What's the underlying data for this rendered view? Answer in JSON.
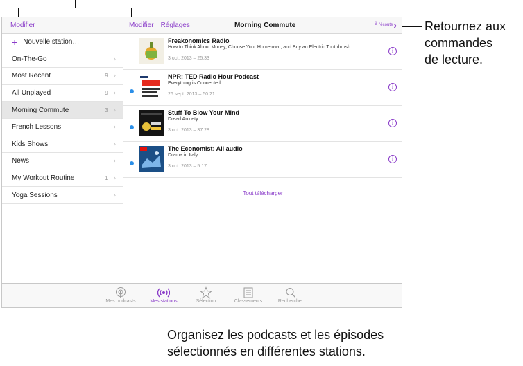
{
  "callouts": {
    "right": [
      "Retournez aux",
      "commandes",
      "de lecture."
    ],
    "bottom": [
      "Organisez les podcasts et les épisodes",
      "sélectionnés en différentes stations."
    ]
  },
  "sidebar": {
    "edit_label": "Modifier",
    "new_station_label": "Nouvelle station…",
    "items": [
      {
        "label": "On-The-Go",
        "count": ""
      },
      {
        "label": "Most Recent",
        "count": "9"
      },
      {
        "label": "All Unplayed",
        "count": "9"
      },
      {
        "label": "Morning Commute",
        "count": "3"
      },
      {
        "label": "French Lessons",
        "count": ""
      },
      {
        "label": "Kids Shows",
        "count": ""
      },
      {
        "label": "News",
        "count": ""
      },
      {
        "label": "My Workout Routine",
        "count": "1"
      },
      {
        "label": "Yoga Sessions",
        "count": ""
      }
    ]
  },
  "main": {
    "edit_label": "Modifier",
    "settings_label": "Réglages",
    "title": "Morning Commute",
    "back_label": "À l'écoute",
    "download_all": "Tout télécharger",
    "episodes": [
      {
        "title": "Freakonomics Radio",
        "subtitle": "How to Think About Money, Choose Your Hometown, and Buy an Electric Toothbrush",
        "date": "3 oct. 2013 – 25:33",
        "unplayed": false,
        "art": "freakonomics"
      },
      {
        "title": "NPR: TED Radio Hour Podcast",
        "subtitle": "Everything is Connected",
        "date": "26 sept. 2013 – 50:21",
        "unplayed": true,
        "art": "ted"
      },
      {
        "title": "Stuff To Blow Your Mind",
        "subtitle": "Dread Anxiety",
        "date": "3 oct. 2013 – 37:28",
        "unplayed": true,
        "art": "stbym"
      },
      {
        "title": "The Economist: All audio",
        "subtitle": "Drama in Italy",
        "date": "3 oct. 2013 – 5:17",
        "unplayed": true,
        "art": "economist"
      }
    ]
  },
  "tabbar": {
    "tabs": [
      {
        "label": "Mes podcasts",
        "icon": "podcast-icon",
        "active": false
      },
      {
        "label": "Mes stations",
        "icon": "broadcast-icon",
        "active": true
      },
      {
        "label": "Sélection",
        "icon": "star-icon",
        "active": false
      },
      {
        "label": "Classements",
        "icon": "list-icon",
        "active": false
      },
      {
        "label": "Rechercher",
        "icon": "search-icon",
        "active": false
      }
    ]
  },
  "colors": {
    "accent": "#8a3cc9",
    "unplayed_dot": "#2b8fe8"
  }
}
